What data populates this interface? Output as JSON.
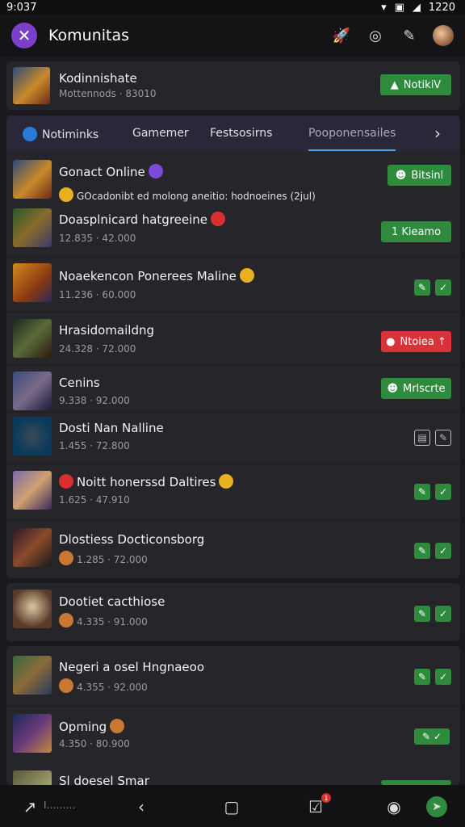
{
  "status_bar": {
    "time": "9:037",
    "battery": "1220"
  },
  "app_bar": {
    "title": "Komunitas"
  },
  "header_card": {
    "title": "Kodinnishate",
    "subtitle": "Mottennods · 83010",
    "button_label": "NotikiV"
  },
  "tabs": [
    {
      "label": "Notiminks"
    },
    {
      "label": "Gamemer"
    },
    {
      "label": "Festsosirns"
    },
    {
      "label": "Pooponensailes"
    }
  ],
  "rows": [
    {
      "title": "Gonact Online",
      "subtitle": "GOcadonibt ed molong aneitio: hodnoeines (2jul)",
      "button": "Bitsinl"
    },
    {
      "title": "Doasplnicard hatgreeine",
      "subtitle": "12.835 · 42.000",
      "button": "1 Kieamo"
    },
    {
      "title": "Noaekencon Ponerees Maline",
      "subtitle": "11.236 · 60.000",
      "button": ""
    },
    {
      "title": "Hrasidomaildng",
      "subtitle": "24.328 · 72.000",
      "button": "Ntoiea ↑"
    },
    {
      "title": "Cenins",
      "subtitle": "9.338 · 92.000",
      "button": "Mrlscrte"
    },
    {
      "title": "Dosti Nan Nalline",
      "subtitle": "1.455 · 72.800",
      "button": ""
    },
    {
      "title": "Noitt honerssd Daltires",
      "subtitle": "1.625 · 47.910",
      "button": ""
    },
    {
      "title": "Dlostiess Docticonsborg",
      "subtitle": "1.285 · 72.000",
      "button": ""
    },
    {
      "title": "Dootiet cacthiose",
      "subtitle": "4.335 · 91.000",
      "button": ""
    },
    {
      "title": "Negeri a osel Hngnaeoo",
      "subtitle": "4.355 · 92.000",
      "button": ""
    },
    {
      "title": "Opming",
      "subtitle": "4.350 · 80.900",
      "button": ""
    },
    {
      "title": "Sl doesel Smar",
      "subtitle": "",
      "button": ""
    }
  ],
  "bottom_nav": {
    "left_label": "I………",
    "badge": "1"
  },
  "colors": {
    "accent_green": "#2f8a3e",
    "accent_red": "#d8333a",
    "tab_underline": "#4aa8e8",
    "logo_purple": "#7b3fc9"
  }
}
